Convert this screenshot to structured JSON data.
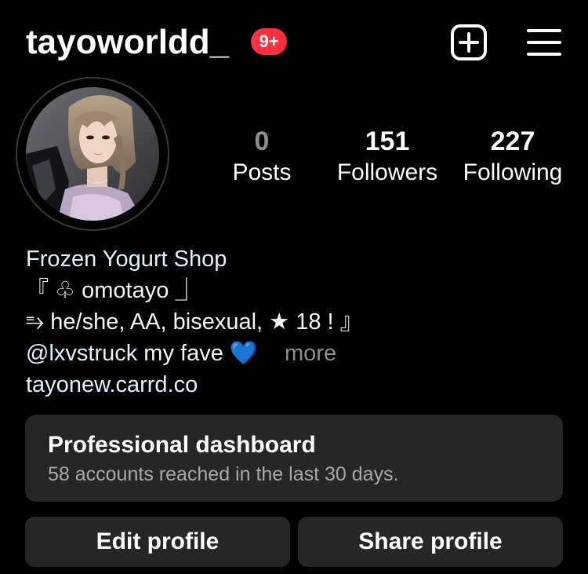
{
  "header": {
    "username": "tayoworldd_",
    "notifications_badge": "9+",
    "badge_color": "#ff3040"
  },
  "icons": {
    "new_post": "plus-square-icon",
    "menu": "hamburger-menu-icon"
  },
  "stats": {
    "posts": {
      "count": "0",
      "label": "Posts"
    },
    "followers": {
      "count": "151",
      "label": "Followers"
    },
    "following": {
      "count": "227",
      "label": "Following"
    }
  },
  "bio": {
    "category": "Frozen Yogurt Shop",
    "line1": "『 ♧ omotayo ⏌",
    "line2": "⥱ he/she, AA, bisexual,  ★ 18 ! 』",
    "mention": "@lxvstruck",
    "line3_text": " my fave ",
    "heart": "💙",
    "more": "more",
    "link": "tayonew.carrd.co"
  },
  "dashboard": {
    "title": "Professional dashboard",
    "subtitle": "58 accounts reached in the last 30 days."
  },
  "buttons": {
    "edit_profile": "Edit profile",
    "share_profile": "Share profile"
  },
  "colors": {
    "background": "#000000",
    "card": "#262626",
    "link": "#e0f1ff",
    "muted": "#8e8e8e"
  }
}
